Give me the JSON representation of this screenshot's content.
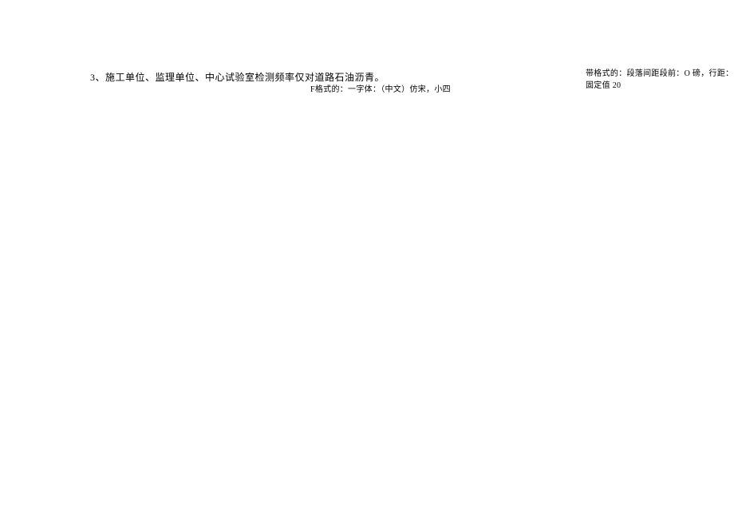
{
  "main": {
    "item_number": "3",
    "separator": "、",
    "text": "施工单位、监理单位、中心试验室检测频率仅对道路石油沥青。"
  },
  "format_notes": {
    "note1": "F格式的：一字体：（中文）仿宋，小四",
    "note2": "带格式的：段落间距段前：O 磅，行距：固定值 20"
  }
}
